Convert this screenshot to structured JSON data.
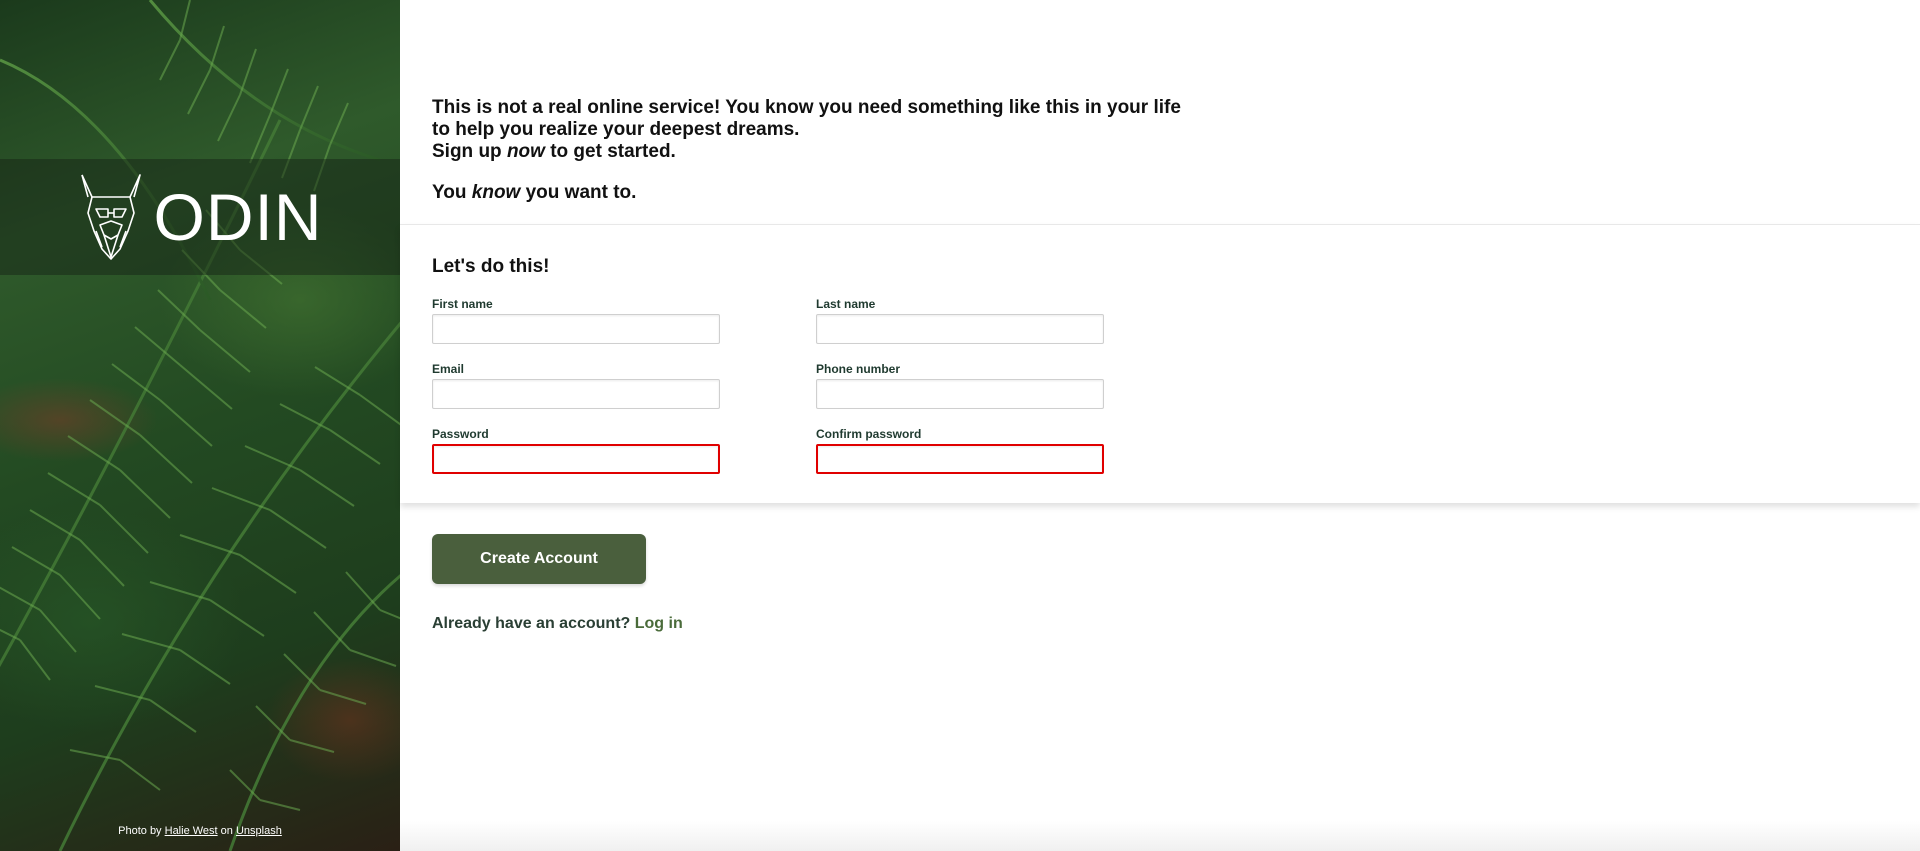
{
  "left_panel": {
    "logo_text": "ODIN",
    "photo_credit": {
      "prefix": "Photo by",
      "photographer": "Halie West",
      "middle": "on",
      "source": "Unsplash"
    }
  },
  "intro": {
    "line1": "This is not a real online service! You know you need something like this in your life",
    "line2": "to help you realize your deepest dreams.",
    "line3_pre": "Sign up ",
    "line3_em": "now",
    "line3_post": " to get started.",
    "line4_pre": "You ",
    "line4_em": "know",
    "line4_post": " you want to."
  },
  "form": {
    "title": "Let's do this!",
    "fields": {
      "first_name": {
        "label": "First name",
        "value": "",
        "invalid": false
      },
      "last_name": {
        "label": "Last name",
        "value": "",
        "invalid": false
      },
      "email": {
        "label": "Email",
        "value": "",
        "invalid": false
      },
      "phone": {
        "label": "Phone number",
        "value": "",
        "invalid": false
      },
      "password": {
        "label": "Password",
        "value": "",
        "invalid": true
      },
      "confirm_password": {
        "label": "Confirm password",
        "value": "",
        "invalid": true
      }
    }
  },
  "actions": {
    "create_label": "Create Account",
    "login_prompt": "Already have an account?",
    "login_link": "Log in"
  },
  "colors": {
    "accent_button": "#4a5f3d",
    "invalid_border": "#e00000",
    "label_text": "#1f3a2f",
    "login_link": "#4a6b3a"
  },
  "icons": {
    "logo": "odin-viking-head-icon"
  }
}
